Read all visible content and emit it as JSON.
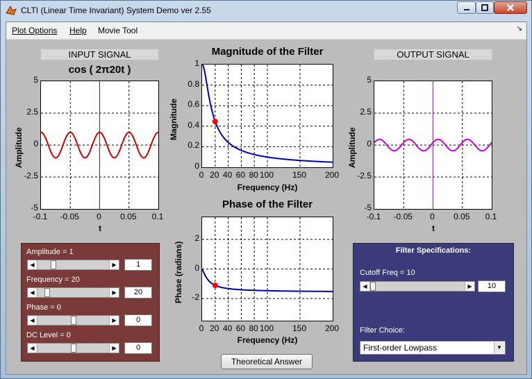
{
  "window": {
    "title": "CLTI (Linear Time Invariant) System Demo ver 2.55"
  },
  "menu": {
    "items": [
      "Plot Options",
      "Help",
      "Movie Tool"
    ]
  },
  "input": {
    "section_label": "INPUT SIGNAL",
    "formula": "cos ( 2π20t )",
    "ylabel": "Amplitude",
    "xlabel": "t",
    "yticks": [
      "5",
      "2.5",
      "0",
      "-2.5",
      "-5"
    ],
    "xticks": [
      "-0.1",
      "-0.05",
      "0",
      "0.05",
      "0.1"
    ]
  },
  "output": {
    "section_label": "OUTPUT SIGNAL",
    "ylabel": "Amplitude",
    "xlabel": "t",
    "yticks": [
      "5",
      "2.5",
      "0",
      "-2.5",
      "-5"
    ],
    "xticks": [
      "-0.1",
      "-0.05",
      "0",
      "0.05",
      "0.1"
    ]
  },
  "magnitude_plot": {
    "title": "Magnitude of the Filter",
    "ylabel": "Magnitude",
    "xlabel": "Frequency (Hz)",
    "yticks": [
      "1",
      "0.8",
      "0.6",
      "0.4",
      "0.2",
      "0"
    ],
    "xticks": [
      "0",
      "20",
      "40",
      "60",
      "80",
      "100",
      "150",
      "200"
    ]
  },
  "phase_plot": {
    "title": "Phase of the Filter",
    "ylabel": "Phase (radians)",
    "xlabel": "Frequency (Hz)",
    "yticks": [
      "2",
      "0",
      "-2"
    ],
    "xticks": [
      "0",
      "20",
      "40",
      "60",
      "80",
      "100",
      "150",
      "200"
    ]
  },
  "signal_controls": {
    "amplitude": {
      "label": "Amplitude = 1",
      "value": "1",
      "fraction": 0.2
    },
    "frequency": {
      "label": "Frequency = 20",
      "value": "20",
      "fraction": 0.1
    },
    "phase": {
      "label": "Phase = 0",
      "value": "0",
      "fraction": 0.5
    },
    "dc_level": {
      "label": "DC Level = 0",
      "value": "0",
      "fraction": 0.5
    }
  },
  "filter_specs": {
    "title": "Filter Specifications:",
    "cutoff_label": "Cutoff Freq = 10",
    "cutoff_value": "10",
    "cutoff_fraction": 0.0,
    "choice_label": "Filter Choice:",
    "choice_value": "First-order Lowpass"
  },
  "buttons": {
    "theoretical_answer": "Theoretical Answer"
  },
  "colors": {
    "input_wave": "#cc0000",
    "output_wave": "#cc00cc",
    "filter_curve": "#0000aa",
    "marker": "#ff0000",
    "signal_panel": "#7b3a3a",
    "filter_panel": "#3b3b7a"
  },
  "chart_data": [
    {
      "type": "line",
      "title": "cos ( 2π20t )",
      "xlabel": "t",
      "ylabel": "Amplitude",
      "xlim": [
        -0.1,
        0.1
      ],
      "ylim": [
        -5,
        5
      ],
      "grid": true,
      "series": [
        {
          "function": "cos(2*pi*20*t)",
          "amplitude": 1,
          "frequency_hz": 20
        }
      ]
    },
    {
      "type": "line",
      "title": "Magnitude of the Filter",
      "xlabel": "Frequency (Hz)",
      "ylabel": "Magnitude",
      "xlim": [
        0,
        200
      ],
      "ylim": [
        0,
        1
      ],
      "grid": true,
      "series": [
        {
          "function": "1/sqrt(1+(f/10)^2)"
        }
      ],
      "marker": {
        "x": 20,
        "y": 0.447
      }
    },
    {
      "type": "line",
      "title": "Phase of the Filter",
      "xlabel": "Frequency (Hz)",
      "ylabel": "Phase (radians)",
      "xlim": [
        0,
        200
      ],
      "ylim": [
        -3.5,
        3.5
      ],
      "grid": true,
      "series": [
        {
          "function": "-atan(f/10)"
        }
      ],
      "marker": {
        "x": 20,
        "y": -1.107
      }
    },
    {
      "type": "line",
      "xlabel": "t",
      "ylabel": "Amplitude",
      "xlim": [
        -0.1,
        0.1
      ],
      "ylim": [
        -5,
        5
      ],
      "grid": true,
      "series": [
        {
          "function": "0.447*cos(2*pi*20*t - 1.107)",
          "amplitude": 0.447,
          "frequency_hz": 20,
          "phase_rad": -1.107
        }
      ]
    }
  ]
}
